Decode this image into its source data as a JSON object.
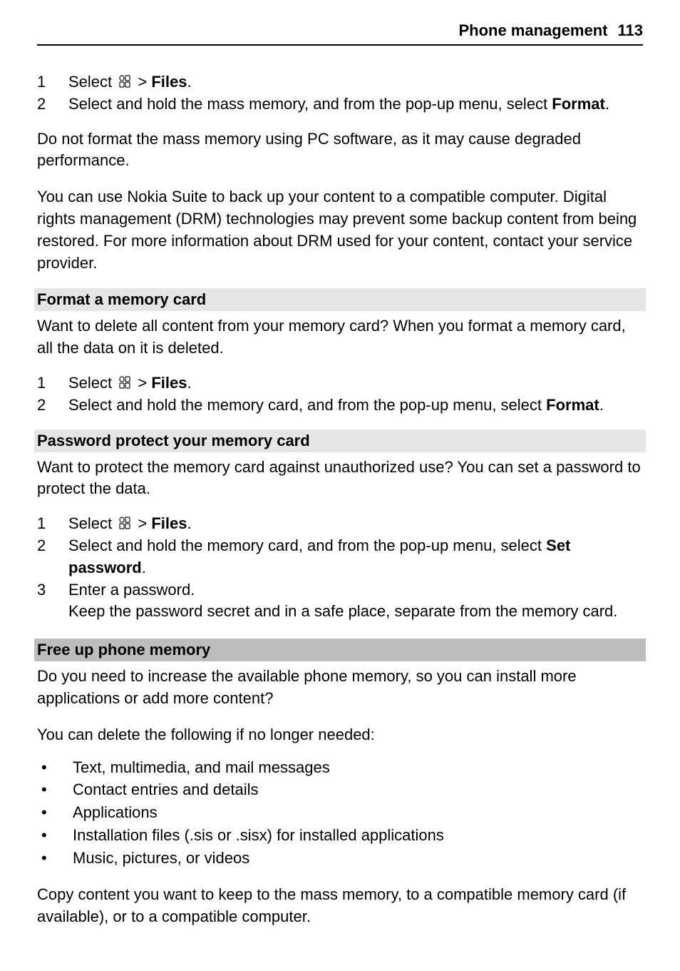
{
  "header": {
    "title": "Phone management",
    "page": "113"
  },
  "intro_steps": [
    {
      "num": "1",
      "prefix": "Select ",
      "mid": " > ",
      "bold": "Files",
      "suffix": "."
    },
    {
      "num": "2",
      "text_a": "Select and hold the mass memory, and from the pop-up menu, select ",
      "bold": "Format",
      "text_b": "."
    }
  ],
  "intro_p1": "Do not format the mass memory using PC software, as it may cause degraded performance.",
  "intro_p2": "You can use Nokia Suite to back up your content to a compatible computer. Digital rights management (DRM) technologies may prevent some backup content from being restored. For more information about DRM used for your content, contact your service provider.",
  "sec1": {
    "title": "Format a memory card",
    "desc": "Want to delete all content from your memory card? When you format a memory card, all the data on it is deleted.",
    "steps": [
      {
        "num": "1",
        "prefix": "Select ",
        "mid": " > ",
        "bold": "Files",
        "suffix": "."
      },
      {
        "num": "2",
        "text_a": "Select and hold the memory card, and from the pop-up menu, select ",
        "bold": "Format",
        "text_b": "."
      }
    ]
  },
  "sec2": {
    "title": "Password protect your memory card",
    "desc": "Want to protect the memory card against unauthorized use? You can set a password to protect the data.",
    "steps": [
      {
        "num": "1",
        "prefix": "Select ",
        "mid": " > ",
        "bold": "Files",
        "suffix": "."
      },
      {
        "num": "2",
        "text_a": "Select and hold the memory card, and from the pop-up menu, select ",
        "bold": "Set password",
        "text_b": "."
      },
      {
        "num": "3",
        "line1": "Enter a password.",
        "line2": "Keep the password secret and in a safe place, separate from the memory card."
      }
    ]
  },
  "sec3": {
    "title": "Free up phone memory",
    "p1": "Do you need to increase the available phone memory, so you can install more applications or add more content?",
    "p2": "You can delete the following if no longer needed:",
    "bullets": [
      "Text, multimedia, and mail messages",
      "Contact entries and details",
      "Applications",
      "Installation files (.sis or .sisx) for installed applications",
      "Music, pictures, or videos"
    ],
    "p3": "Copy content you want to keep to the mass memory, to a compatible memory card (if available), or to a compatible computer."
  }
}
